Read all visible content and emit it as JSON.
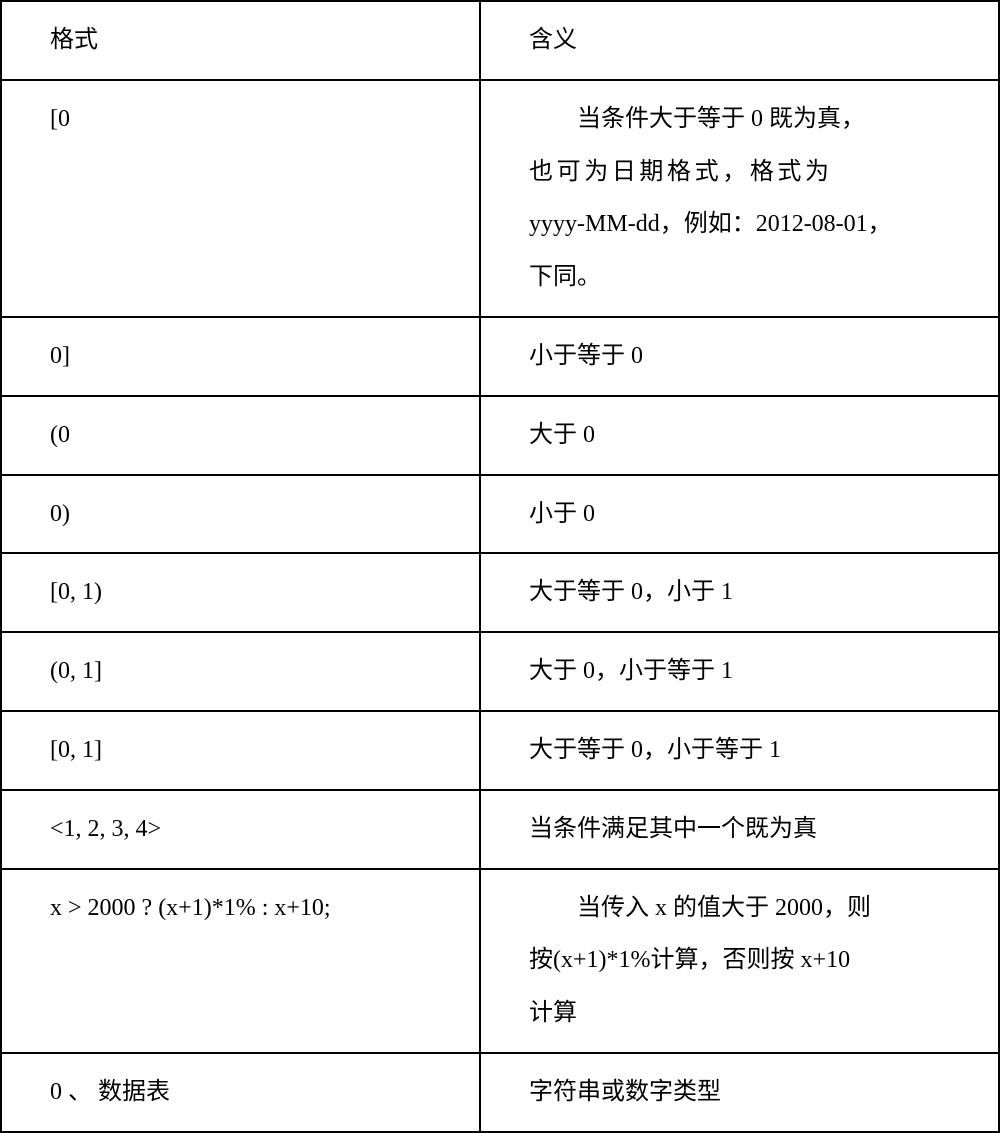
{
  "headers": {
    "col1": "格式",
    "col2": "含义"
  },
  "rows": [
    {
      "c1": "[0",
      "c2_lines": [
        "当条件大于等于 0 既为真，",
        "也可为日期格式，格式为",
        "yyyy-MM-dd，例如：2012-08-01，",
        "下同。"
      ]
    },
    {
      "c1": "0]",
      "c2": "小于等于 0"
    },
    {
      "c1": "(0",
      "c2": "大于 0"
    },
    {
      "c1": "0)",
      "c2": "小于 0"
    },
    {
      "c1": "[0, 1)",
      "c2": "大于等于 0，小于 1"
    },
    {
      "c1": "(0, 1]",
      "c2": "大于 0，小于等于 1"
    },
    {
      "c1": "[0, 1]",
      "c2": "大于等于 0，小于等于 1"
    },
    {
      "c1": "<1, 2, 3, 4>",
      "c2": "当条件满足其中一个既为真"
    },
    {
      "c1": "x > 2000 ? (x+1)*1% : x+10;",
      "c2_lines": [
        "当传入 x 的值大于 2000，则",
        "按(x+1)*1%计算，否则按 x+10",
        "计算"
      ]
    },
    {
      "c1": "0 、 数据表",
      "c2": "字符串或数字类型"
    }
  ]
}
